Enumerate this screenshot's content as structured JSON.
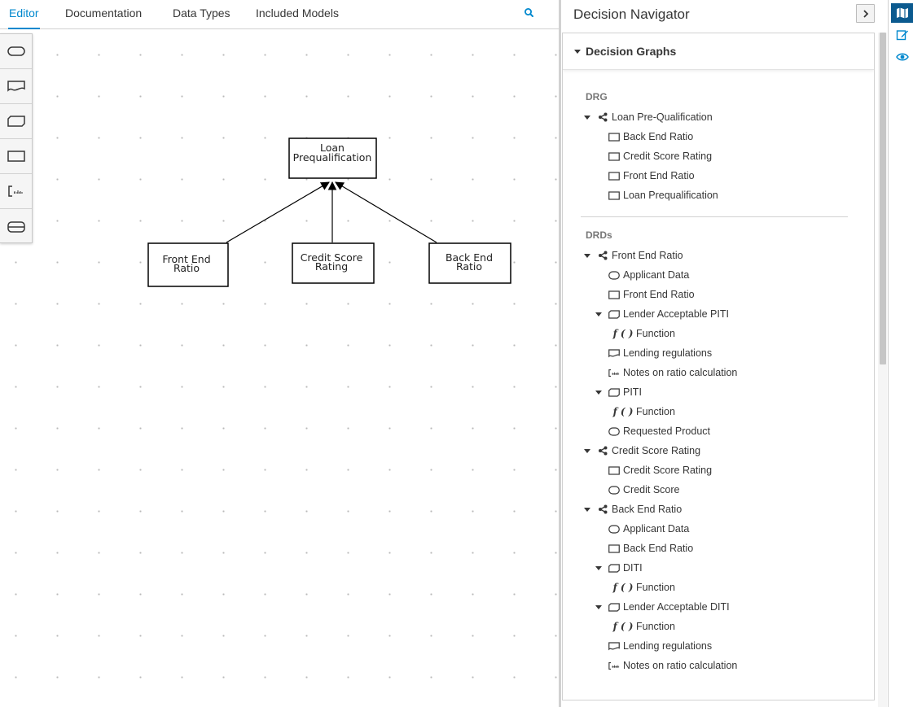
{
  "tabs": [
    {
      "label": "Editor",
      "active": true
    },
    {
      "label": "Documentation"
    },
    {
      "label": "Data Types"
    },
    {
      "label": "Included Models"
    }
  ],
  "palette": [
    "input-data",
    "knowledge-source",
    "business-knowledge-model",
    "decision",
    "text-annotation",
    "decision-service"
  ],
  "diagram": {
    "nodes": [
      {
        "id": "loan",
        "line1": "Loan",
        "line2": "Prequalification"
      },
      {
        "id": "front",
        "line1": "Front End",
        "line2": "Ratio"
      },
      {
        "id": "credit",
        "line1": "Credit Score",
        "line2": "Rating"
      },
      {
        "id": "back",
        "line1": "Back End",
        "line2": "Ratio"
      }
    ]
  },
  "navigator": {
    "title": "Decision Navigator",
    "panel_title": "Decision Graphs",
    "drg_label": "DRG",
    "drds_label": "DRDs",
    "drg": [
      {
        "label": "Loan Pre-Qualification",
        "icon": "graph-icon",
        "level": 0,
        "expanded": true
      },
      {
        "label": "Back End Ratio",
        "icon": "decision-icon",
        "level": 1
      },
      {
        "label": "Credit Score Rating",
        "icon": "decision-icon",
        "level": 1
      },
      {
        "label": "Front End Ratio",
        "icon": "decision-icon",
        "level": 1
      },
      {
        "label": "Loan Prequalification",
        "icon": "decision-icon",
        "level": 1
      }
    ],
    "drds": [
      {
        "label": "Front End Ratio",
        "icon": "graph-icon",
        "level": 0,
        "expanded": true
      },
      {
        "label": "Applicant Data",
        "icon": "input-data-icon",
        "level": 1
      },
      {
        "label": "Front End Ratio",
        "icon": "decision-icon",
        "level": 1
      },
      {
        "label": "Lender Acceptable PITI",
        "icon": "bkm-icon",
        "level": 1,
        "expanded": true
      },
      {
        "label": "Function",
        "icon": "function-icon",
        "level": 2
      },
      {
        "label": "Lending regulations",
        "icon": "knowledge-source-icon",
        "level": 1
      },
      {
        "label": "Notes on ratio calculation",
        "icon": "text-annotation-icon",
        "level": 1
      },
      {
        "label": "PITI",
        "icon": "bkm-icon",
        "level": 1,
        "expanded": true
      },
      {
        "label": "Function",
        "icon": "function-icon",
        "level": 2
      },
      {
        "label": "Requested Product",
        "icon": "input-data-icon",
        "level": 1
      },
      {
        "label": "Credit Score Rating",
        "icon": "graph-icon",
        "level": 0,
        "expanded": true
      },
      {
        "label": "Credit Score Rating",
        "icon": "decision-icon",
        "level": 1
      },
      {
        "label": "Credit Score",
        "icon": "input-data-icon",
        "level": 1
      },
      {
        "label": "Back End Ratio",
        "icon": "graph-icon",
        "level": 0,
        "expanded": true
      },
      {
        "label": "Applicant Data",
        "icon": "input-data-icon",
        "level": 1
      },
      {
        "label": "Back End Ratio",
        "icon": "decision-icon",
        "level": 1
      },
      {
        "label": "DITI",
        "icon": "bkm-icon",
        "level": 1,
        "expanded": true
      },
      {
        "label": "Function",
        "icon": "function-icon",
        "level": 2
      },
      {
        "label": "Lender Acceptable DITI",
        "icon": "bkm-icon",
        "level": 1,
        "expanded": true
      },
      {
        "label": "Function",
        "icon": "function-icon",
        "level": 2
      },
      {
        "label": "Lending regulations",
        "icon": "knowledge-source-icon",
        "level": 1
      },
      {
        "label": "Notes on ratio calculation",
        "icon": "text-annotation-icon",
        "level": 1
      }
    ]
  },
  "function_glyph": "f ( )",
  "side_strip": [
    "decision-navigator-icon",
    "properties-icon",
    "preview-icon"
  ],
  "colors": {
    "accent": "#0088ce",
    "active_strip": "#0b5a8f"
  }
}
